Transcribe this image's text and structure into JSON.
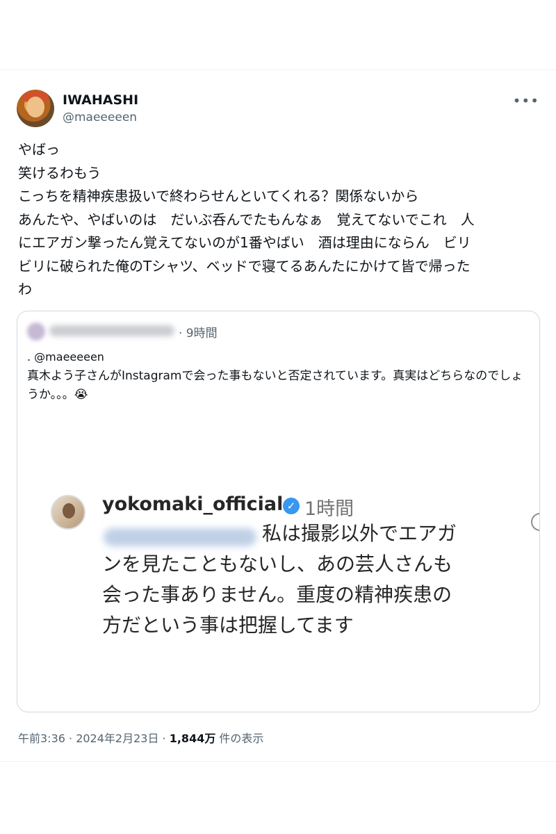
{
  "tweet": {
    "display_name": "IWAHASHI",
    "handle": "@maeeeeen",
    "more_icon": "more-horizontal-icon",
    "body_lines": [
      "やばっ",
      "笑けるわもう",
      "こっちを精神疾患扱いで終わらせんといてくれる？関係ないから",
      "あんたや、やばいのは　だいぶ呑んでたもんなぁ　覚えてないでこれ　人",
      "にエアガン撃ったん覚えてないのが1番やばい　酒は理由にならん　ビリ",
      "ビリに破られた俺のTシャツ、ベッドで寝てるあんたにかけて皆で帰った",
      "わ"
    ]
  },
  "quote": {
    "time": "· 9時間",
    "mention": ". @maeeeeen",
    "text": "真木よう子さんがInstagramで会った事もないと否定されています。真実はどちらなのでしょうか。。。😭",
    "instagram": {
      "username": "yokomaki_official",
      "verified_icon": "verified-badge-icon",
      "time": "1時間",
      "comment_lines": [
        "私は撮影以外でエアガ",
        "ンを見たこともないし、あの芸人さんも",
        "会った事ありません。重度の精神疾患の",
        "方だという事は把握してます"
      ]
    }
  },
  "meta": {
    "time": "午前3:36 · 2024年2月23日 · ",
    "views": "1,844万",
    "views_suffix": " 件の表示"
  }
}
